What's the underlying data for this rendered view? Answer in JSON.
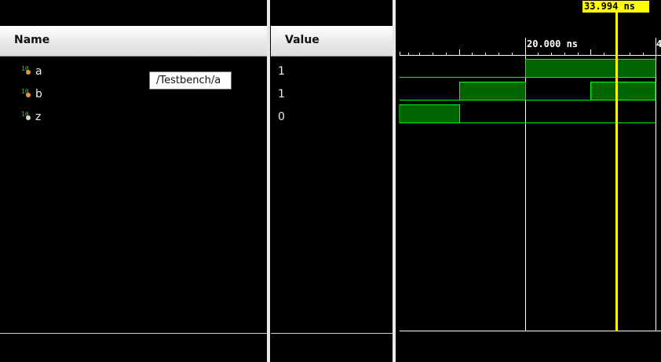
{
  "columns": {
    "name_header": "Name",
    "value_header": "Value"
  },
  "signals": [
    {
      "name": "a",
      "value": "1",
      "icon": "logic-signal-icon"
    },
    {
      "name": "b",
      "value": "1",
      "icon": "logic-signal-icon"
    },
    {
      "name": "z",
      "value": "0",
      "icon": "logic-output-icon"
    }
  ],
  "tooltip": "/Testbench/a",
  "waveform": {
    "cursor_time": "33.994 ns",
    "time_marker": "20.000 ns",
    "next_marker_partial": "4",
    "colors": {
      "background": "#000000",
      "trace": "#00ff00",
      "high_fill": "#006400",
      "cursor": "#ffff00",
      "grid": "#ffffff"
    }
  }
}
